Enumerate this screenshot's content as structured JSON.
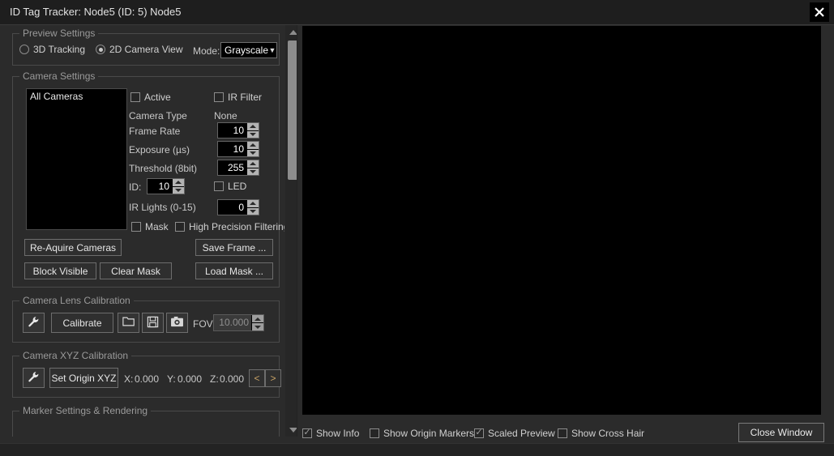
{
  "window": {
    "title": "ID Tag Tracker: Node5 (ID: 5) Node5",
    "close_icon": "close-icon"
  },
  "preview_settings": {
    "legend": "Preview Settings",
    "radios": [
      {
        "label": "3D Tracking",
        "selected": false
      },
      {
        "label": "2D Camera View",
        "selected": true
      }
    ],
    "mode_label": "Mode:",
    "mode_value": "Grayscale",
    "mode_options": [
      "Grayscale"
    ]
  },
  "camera_settings": {
    "legend": "Camera Settings",
    "camera_list": [
      "All Cameras"
    ],
    "active_label": "Active",
    "active_checked": false,
    "ir_filter_label": "IR Filter",
    "ir_filter_checked": false,
    "camera_type_label": "Camera Type",
    "camera_type_value": "None",
    "frame_rate_label": "Frame Rate",
    "frame_rate_value": "10",
    "exposure_label": "Exposure (µs)",
    "exposure_value": "10",
    "threshold_label": "Threshold (8bit)",
    "threshold_value": "255",
    "id_label": "ID:",
    "id_value": "10",
    "led_label": "LED",
    "led_checked": false,
    "ir_lights_label": "IR Lights (0-15)",
    "ir_lights_value": "0",
    "mask_label": "Mask",
    "mask_checked": false,
    "hpf_label": "High Precision Filtering",
    "hpf_checked": false,
    "buttons": {
      "reacquire": "Re-Aquire Cameras",
      "save_frame": "Save Frame ...",
      "block_visible": "Block Visible",
      "clear_mask": "Clear Mask",
      "load_mask": "Load Mask ..."
    }
  },
  "lens_calibration": {
    "legend": "Camera Lens Calibration",
    "wrench_icon": "wrench-icon",
    "calibrate_label": "Calibrate",
    "open_icon": "folder-open-icon",
    "save_icon": "floppy-disk-icon",
    "snapshot_icon": "camera-icon",
    "fov_label": "FOV",
    "fov_value": "10.000"
  },
  "xyz_calibration": {
    "legend": "Camera XYZ Calibration",
    "wrench_icon": "wrench-icon",
    "set_origin_label": "Set Origin XYZ",
    "x_label": "X:",
    "x_value": "0.000",
    "y_label": "Y:",
    "y_value": "0.000",
    "z_label": "Z:",
    "z_value": "0.000",
    "prev_label": "<",
    "next_label": ">"
  },
  "marker_settings": {
    "legend": "Marker Settings & Rendering"
  },
  "footer": {
    "checkboxes": [
      {
        "label": "Show Info",
        "checked": true
      },
      {
        "label": "Show Origin Markers",
        "checked": false
      },
      {
        "label": "Scaled Preview",
        "checked": true
      },
      {
        "label": "Show Cross Hair",
        "checked": false
      }
    ],
    "close_window_label": "Close Window"
  },
  "colors": {
    "window_bg": "#2b2b2b",
    "titlebar_bg": "#1e1e1e",
    "viewport_bg": "#000000",
    "text": "#c8c8c8",
    "border": "#4a4a4a"
  }
}
